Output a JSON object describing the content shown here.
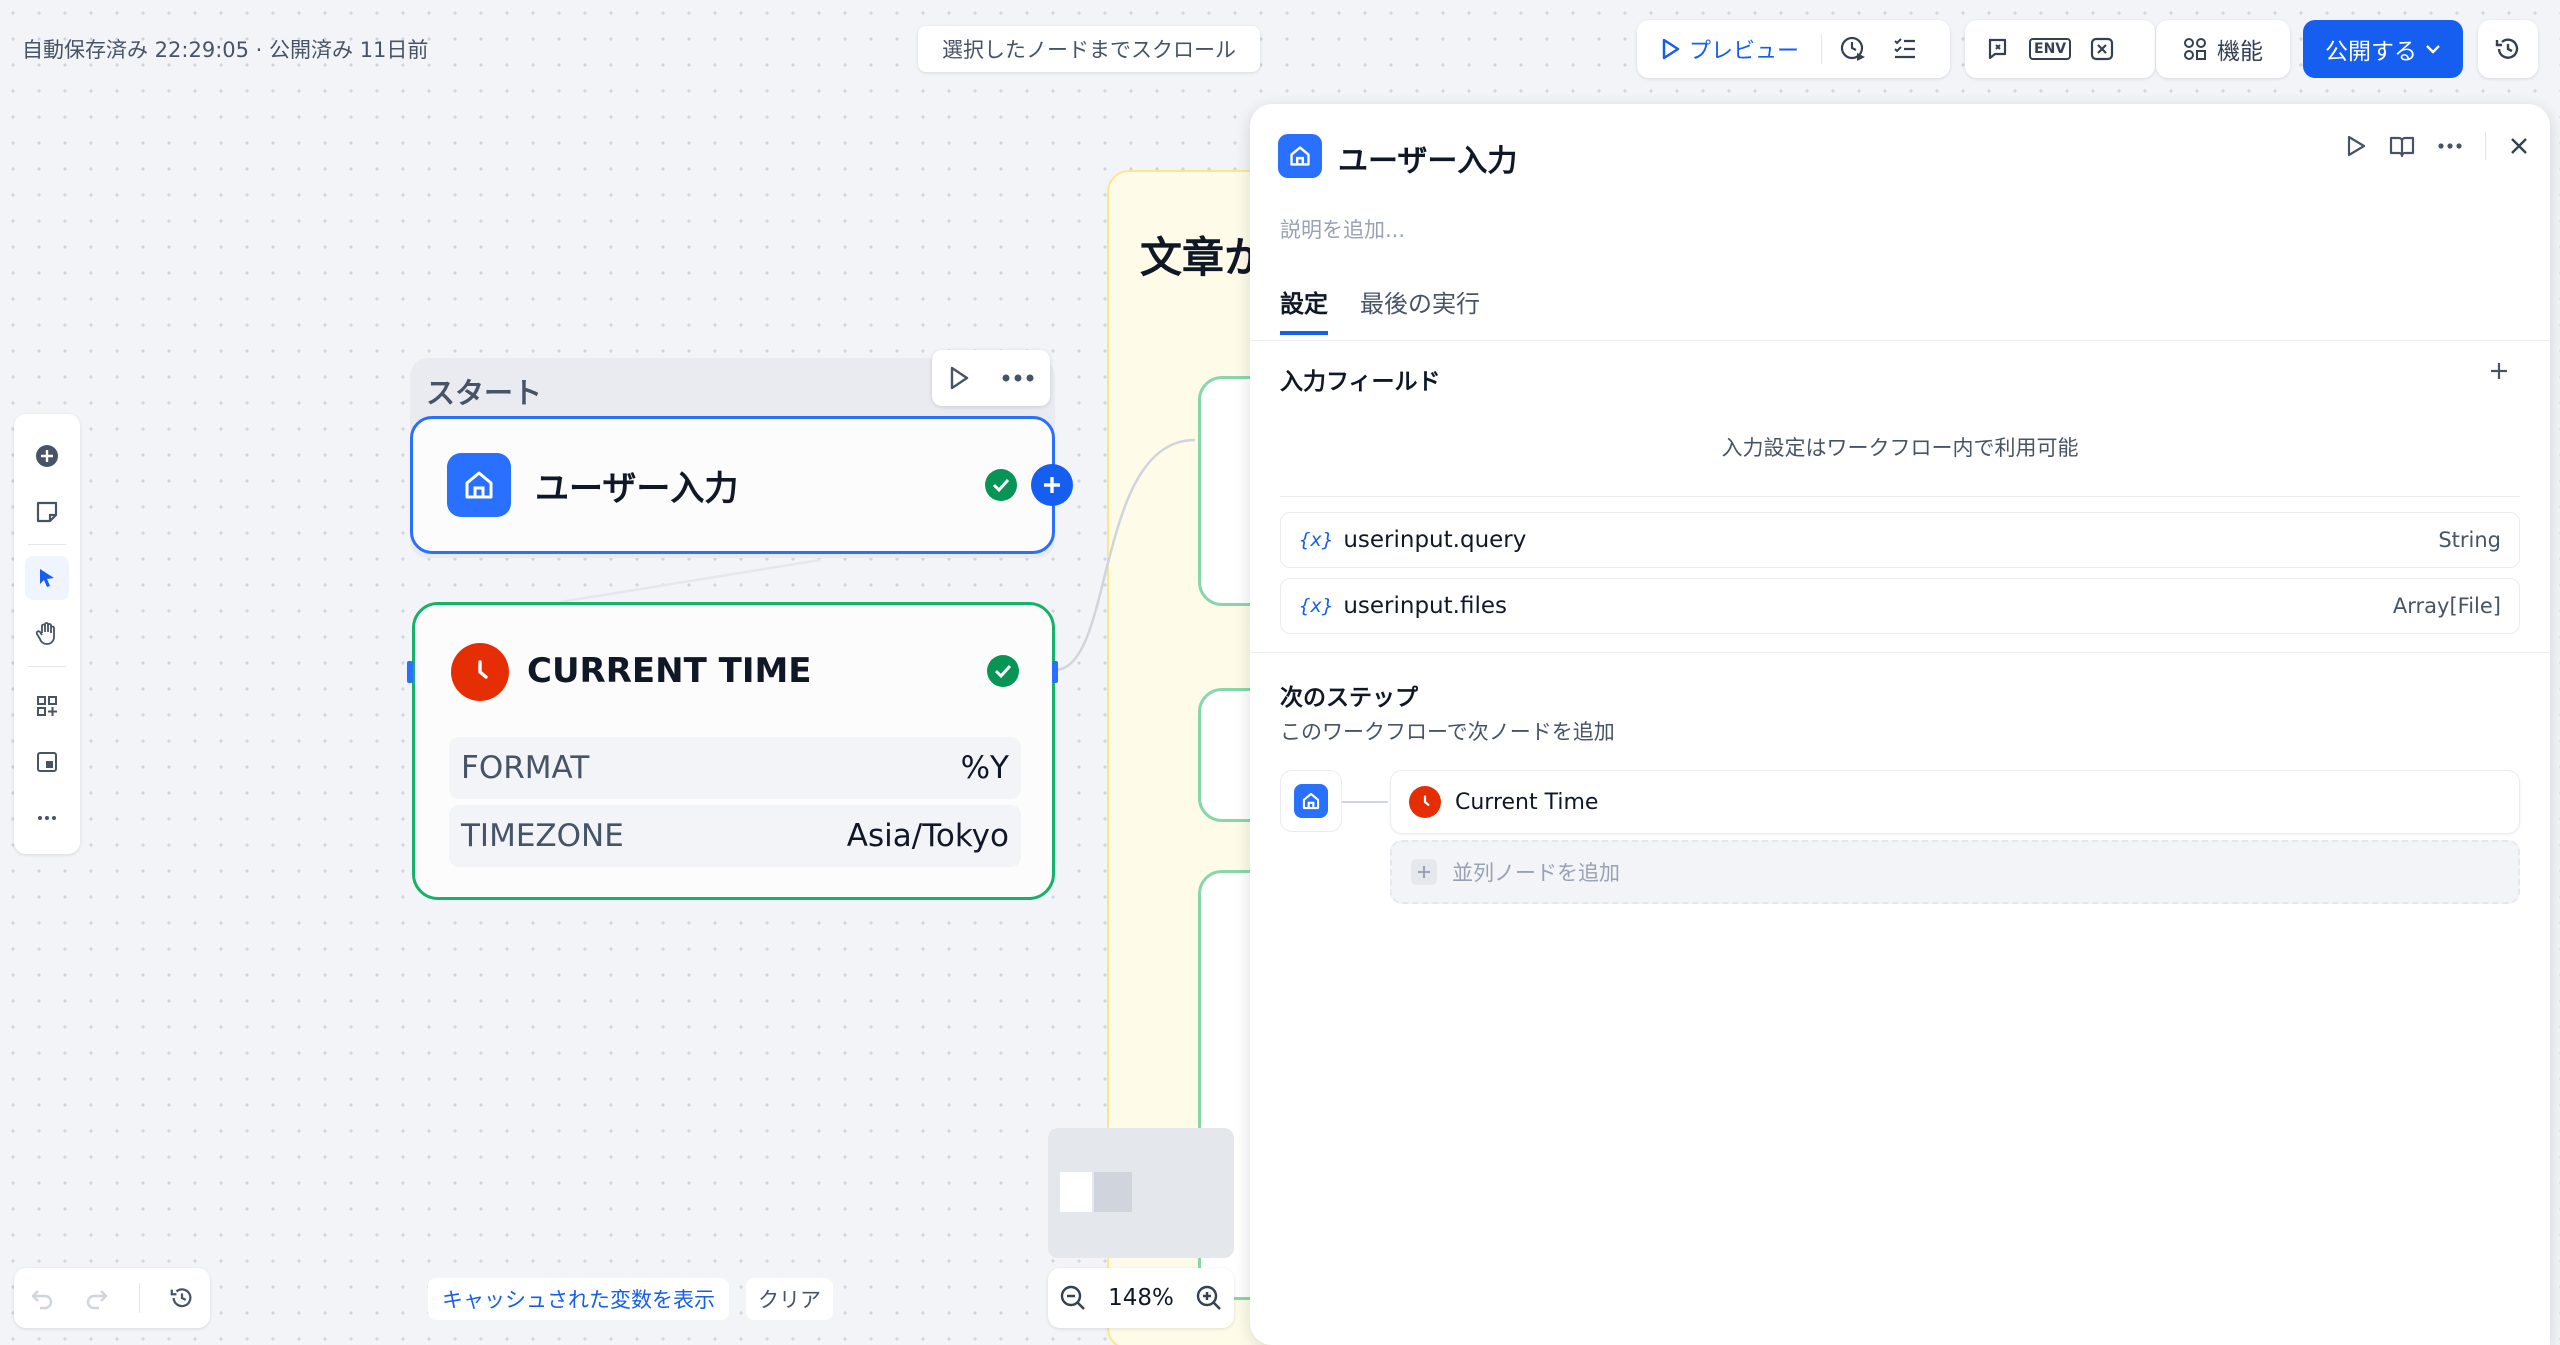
{
  "topbar": {
    "autosave": "自動保存済み 22:29:05 · 公開済み 11日前",
    "scroll_to_node": "選択したノードまでスクロール",
    "preview": "プレビュー",
    "env": "ENV",
    "features": "機能",
    "publish": "公開する"
  },
  "canvas": {
    "start_label": "スタート",
    "user_input_node": {
      "title": "ユーザー入力"
    },
    "time_node": {
      "title": "CURRENT TIME",
      "rows": [
        {
          "key": "FORMAT",
          "value": "%Y"
        },
        {
          "key": "TIMEZONE",
          "value": "Asia/Tokyo"
        }
      ]
    },
    "iteration_title": "文章か",
    "zoom": "148%",
    "cached_vars": "キャッシュされた変数を表示",
    "clear": "クリア"
  },
  "panel": {
    "title": "ユーザー入力",
    "description_placeholder": "説明を追加...",
    "tabs": [
      {
        "label": "設定",
        "active": true
      },
      {
        "label": "最後の実行",
        "active": false
      }
    ],
    "input_fields_title": "入力フィールド",
    "info_text": "入力設定はワークフロー内で利用可能",
    "variables": [
      {
        "name": "userinput.query",
        "type": "String"
      },
      {
        "name": "userinput.files",
        "type": "Array[File]"
      }
    ],
    "var_icon": "{x}",
    "next_step_title": "次のステップ",
    "next_step_desc": "このワークフローで次ノードを追加",
    "next_node": "Current Time",
    "add_parallel": "並列ノードを追加"
  },
  "colors": {
    "accent": "#155eef",
    "success": "#17b26a",
    "time_node": "#e62e05"
  }
}
